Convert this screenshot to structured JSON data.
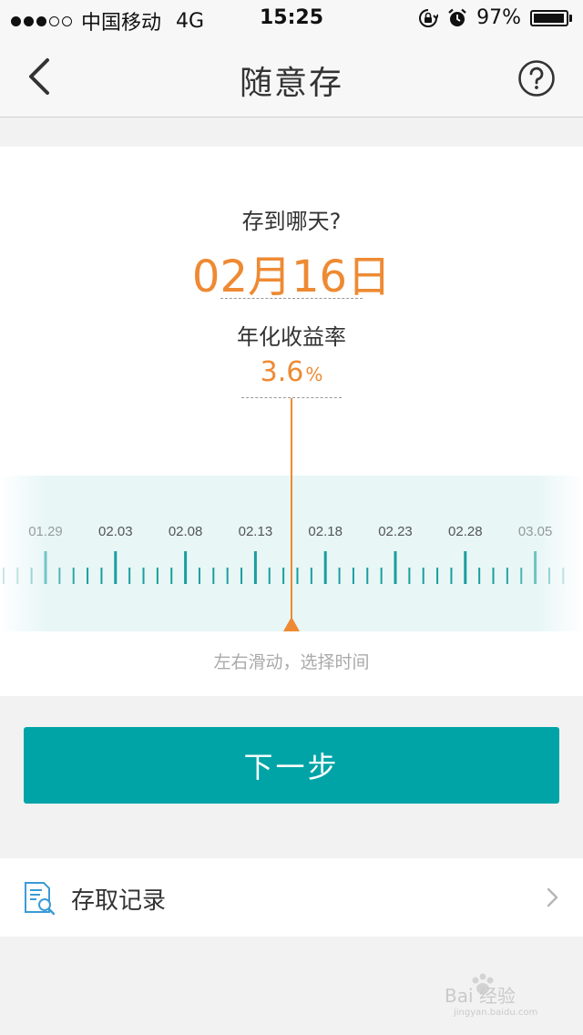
{
  "status_bar": {
    "carrier": "中国移动",
    "network": "4G",
    "time": "15:25",
    "battery": "97%",
    "battery_level": 0.97,
    "signal_bars_filled": 3,
    "signal_bars_total": 5
  },
  "nav": {
    "title": "随意存",
    "back_icon": "chevron-left-icon",
    "help_icon": "question-circle-icon"
  },
  "deposit": {
    "question": "存到哪天?",
    "selected_date": "02月16日",
    "rate_label": "年化收益率",
    "rate_value": "3.6",
    "rate_unit": "%"
  },
  "scale": {
    "labels": [
      "01.29",
      "02.03",
      "02.08",
      "02.13",
      "02.18",
      "02.23",
      "02.28",
      "03.05"
    ],
    "hint": "左右滑动，选择时间"
  },
  "actions": {
    "next": "下一步"
  },
  "records": {
    "label": "存取记录",
    "icon": "document-search-icon",
    "chevron": "chevron-right-icon"
  },
  "watermark": {
    "text": "Baidu经验",
    "subtext": "jingyan.baidu.com"
  },
  "colors": {
    "accent_orange": "#ee8a33",
    "teal": "#00a4a6",
    "tick_teal": "#1a9e9e"
  }
}
